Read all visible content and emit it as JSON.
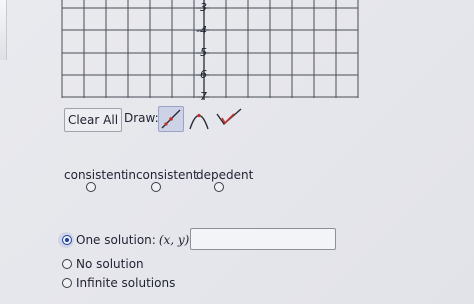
{
  "graph": {
    "y_ticks": [
      "-3",
      "-4",
      "-5",
      "-6",
      "-7"
    ]
  },
  "toolbar": {
    "clear_label": "Clear All",
    "draw_label": "Draw:",
    "tools": [
      "line-tool-icon",
      "parabola-tool-icon",
      "check-tool-icon"
    ],
    "selected_tool": "line-tool-icon",
    "accent_color": "#c0312b"
  },
  "classification": {
    "options": [
      "consistent",
      "inconsistent",
      "depedent"
    ]
  },
  "solutions": {
    "one_solution_label": "One solution: ",
    "one_solution_math": "(x, y) =",
    "no_solution_label": "No solution",
    "infinite_label": "Infinite solutions",
    "selected": "one_solution"
  }
}
